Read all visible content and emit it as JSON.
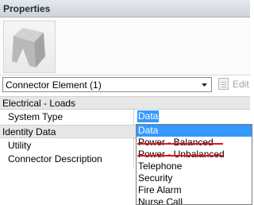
{
  "title": "Properties",
  "type_selector": {
    "value": "Connector Element (1)",
    "edit_type_label": "Edit"
  },
  "groups": [
    {
      "title": "Electrical - Loads",
      "rows": [
        {
          "name": "System Type",
          "value": "Data"
        }
      ]
    },
    {
      "title": "Identity Data",
      "rows": [
        {
          "name": "Utility"
        },
        {
          "name": "Connector Description"
        }
      ]
    }
  ],
  "dropdown": {
    "items": [
      {
        "label": "Data",
        "selected": true
      },
      {
        "label": "Power - Balanced",
        "struck_out": true
      },
      {
        "label": "Power - Unbalanced",
        "struck_out": true
      },
      {
        "label": "Telephone"
      },
      {
        "label": "Security"
      },
      {
        "label": "Fire Alarm"
      },
      {
        "label": "Nurse Call"
      }
    ],
    "strike_color": "#e0141e"
  },
  "colors": {
    "selection": "#3399ff"
  },
  "icons": {
    "preview": "family-thumbnail-icon",
    "dropdown_arrow": "chevron-down-icon",
    "edit_type": "edit-type-icon"
  }
}
